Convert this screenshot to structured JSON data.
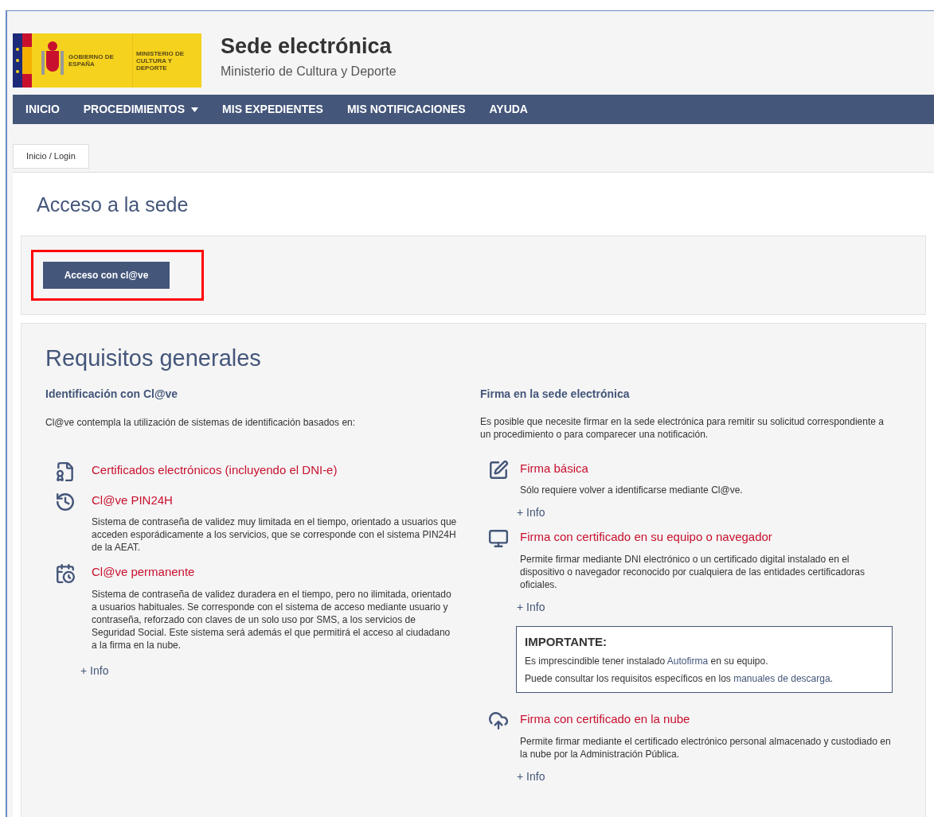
{
  "header": {
    "logo_texts": [
      "GOBIERNO DE ESPAÑA",
      "MINISTERIO DE CULTURA Y DEPORTE"
    ],
    "title": "Sede electrónica",
    "subtitle": "Ministerio de Cultura y Deporte"
  },
  "nav": [
    {
      "label": "INICIO",
      "dropdown": false
    },
    {
      "label": "PROCEDIMIENTOS",
      "dropdown": true
    },
    {
      "label": "MIS EXPEDIENTES",
      "dropdown": false
    },
    {
      "label": "MIS NOTIFICACIONES",
      "dropdown": false
    },
    {
      "label": "AYUDA",
      "dropdown": false
    }
  ],
  "breadcrumb": "Inicio / Login",
  "page_title": "Acceso a la sede",
  "access": {
    "button": "Acceso con cl@ve",
    "highlighted": true
  },
  "requirements": {
    "title": "Requisitos generales",
    "left": {
      "heading": "Identificación con Cl@ve",
      "intro": "Cl@ve contempla la utilización de sistemas de identificación basados en:",
      "items": [
        {
          "kind": "certificate",
          "title": "Certificados electrónicos (incluyendo el DNI-e)"
        },
        {
          "kind": "history",
          "title": "Cl@ve PIN24H",
          "description": "Sistema de contraseña de validez muy limitada en el tiempo, orientado a usuarios que acceden esporádicamente a los servicios, que se corresponde con el sistema PIN24H de la AEAT."
        },
        {
          "kind": "calendar-clock",
          "title": "Cl@ve permanente",
          "description": "Sistema de contraseña de validez duradera en el tiempo, pero no ilimitada, orientado a usuarios habituales. Se corresponde con el sistema de acceso mediante usuario y contraseña, reforzado con claves de un solo uso por SMS, a los servicios de Seguridad Social. Este sistema será además el que permitirá el acceso al ciudadano a la firma en la nube."
        }
      ],
      "info_link": "+ Info"
    },
    "right": {
      "heading": "Firma en la sede electrónica",
      "intro": "Es posible que necesite firmar en la sede electrónica para remitir su solicitud correspondiente a un procedimiento o para comparecer una notificación.",
      "items": [
        {
          "kind": "edit",
          "title": "Firma básica",
          "description": "Sólo requiere volver a identificarse mediante Cl@ve.",
          "info_link": "+ Info"
        },
        {
          "kind": "monitor",
          "title": "Firma con certificado en su equipo o navegador",
          "description": "Permite firmar mediante DNI electrónico o un certificado digital instalado en el dispositivo o navegador reconocido por cualquiera de las entidades certificadoras oficiales.",
          "info_link": "+ Info",
          "notice": {
            "title": "IMPORTANTE:",
            "lines": [
              {
                "before": "Es imprescindible tener instalado ",
                "link": "Autofirma",
                "after": " en su equipo."
              },
              {
                "before": "Puede consultar los requisitos específicos en los ",
                "link": "manuales de descarga",
                "after": "."
              }
            ]
          }
        },
        {
          "kind": "cloud-upload",
          "title": "Firma con certificado en la nube",
          "description": "Permite firmar mediante el certificado electrónico personal almacenado y custodiado en la nube por la Administración Pública.",
          "info_link": "+ Info"
        }
      ]
    }
  }
}
